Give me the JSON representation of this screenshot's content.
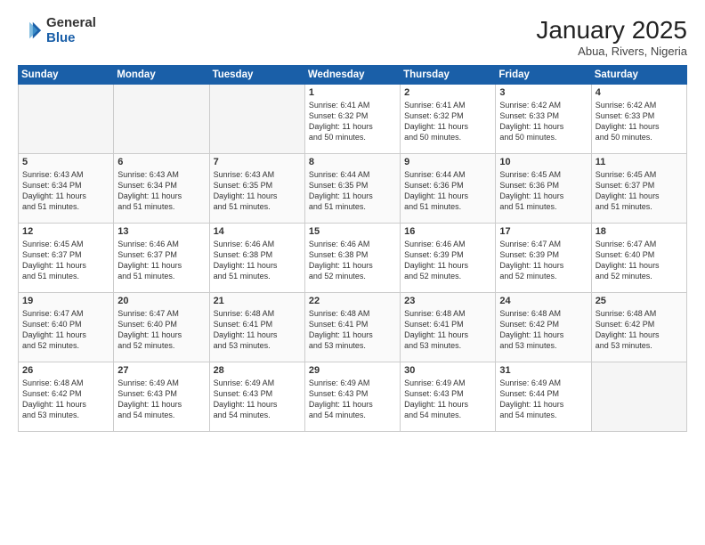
{
  "header": {
    "logo_general": "General",
    "logo_blue": "Blue",
    "month_title": "January 2025",
    "subtitle": "Abua, Rivers, Nigeria"
  },
  "weekdays": [
    "Sunday",
    "Monday",
    "Tuesday",
    "Wednesday",
    "Thursday",
    "Friday",
    "Saturday"
  ],
  "weeks": [
    [
      {
        "day": "",
        "info": ""
      },
      {
        "day": "",
        "info": ""
      },
      {
        "day": "",
        "info": ""
      },
      {
        "day": "1",
        "info": "Sunrise: 6:41 AM\nSunset: 6:32 PM\nDaylight: 11 hours\nand 50 minutes."
      },
      {
        "day": "2",
        "info": "Sunrise: 6:41 AM\nSunset: 6:32 PM\nDaylight: 11 hours\nand 50 minutes."
      },
      {
        "day": "3",
        "info": "Sunrise: 6:42 AM\nSunset: 6:33 PM\nDaylight: 11 hours\nand 50 minutes."
      },
      {
        "day": "4",
        "info": "Sunrise: 6:42 AM\nSunset: 6:33 PM\nDaylight: 11 hours\nand 50 minutes."
      }
    ],
    [
      {
        "day": "5",
        "info": "Sunrise: 6:43 AM\nSunset: 6:34 PM\nDaylight: 11 hours\nand 51 minutes."
      },
      {
        "day": "6",
        "info": "Sunrise: 6:43 AM\nSunset: 6:34 PM\nDaylight: 11 hours\nand 51 minutes."
      },
      {
        "day": "7",
        "info": "Sunrise: 6:43 AM\nSunset: 6:35 PM\nDaylight: 11 hours\nand 51 minutes."
      },
      {
        "day": "8",
        "info": "Sunrise: 6:44 AM\nSunset: 6:35 PM\nDaylight: 11 hours\nand 51 minutes."
      },
      {
        "day": "9",
        "info": "Sunrise: 6:44 AM\nSunset: 6:36 PM\nDaylight: 11 hours\nand 51 minutes."
      },
      {
        "day": "10",
        "info": "Sunrise: 6:45 AM\nSunset: 6:36 PM\nDaylight: 11 hours\nand 51 minutes."
      },
      {
        "day": "11",
        "info": "Sunrise: 6:45 AM\nSunset: 6:37 PM\nDaylight: 11 hours\nand 51 minutes."
      }
    ],
    [
      {
        "day": "12",
        "info": "Sunrise: 6:45 AM\nSunset: 6:37 PM\nDaylight: 11 hours\nand 51 minutes."
      },
      {
        "day": "13",
        "info": "Sunrise: 6:46 AM\nSunset: 6:37 PM\nDaylight: 11 hours\nand 51 minutes."
      },
      {
        "day": "14",
        "info": "Sunrise: 6:46 AM\nSunset: 6:38 PM\nDaylight: 11 hours\nand 51 minutes."
      },
      {
        "day": "15",
        "info": "Sunrise: 6:46 AM\nSunset: 6:38 PM\nDaylight: 11 hours\nand 52 minutes."
      },
      {
        "day": "16",
        "info": "Sunrise: 6:46 AM\nSunset: 6:39 PM\nDaylight: 11 hours\nand 52 minutes."
      },
      {
        "day": "17",
        "info": "Sunrise: 6:47 AM\nSunset: 6:39 PM\nDaylight: 11 hours\nand 52 minutes."
      },
      {
        "day": "18",
        "info": "Sunrise: 6:47 AM\nSunset: 6:40 PM\nDaylight: 11 hours\nand 52 minutes."
      }
    ],
    [
      {
        "day": "19",
        "info": "Sunrise: 6:47 AM\nSunset: 6:40 PM\nDaylight: 11 hours\nand 52 minutes."
      },
      {
        "day": "20",
        "info": "Sunrise: 6:47 AM\nSunset: 6:40 PM\nDaylight: 11 hours\nand 52 minutes."
      },
      {
        "day": "21",
        "info": "Sunrise: 6:48 AM\nSunset: 6:41 PM\nDaylight: 11 hours\nand 53 minutes."
      },
      {
        "day": "22",
        "info": "Sunrise: 6:48 AM\nSunset: 6:41 PM\nDaylight: 11 hours\nand 53 minutes."
      },
      {
        "day": "23",
        "info": "Sunrise: 6:48 AM\nSunset: 6:41 PM\nDaylight: 11 hours\nand 53 minutes."
      },
      {
        "day": "24",
        "info": "Sunrise: 6:48 AM\nSunset: 6:42 PM\nDaylight: 11 hours\nand 53 minutes."
      },
      {
        "day": "25",
        "info": "Sunrise: 6:48 AM\nSunset: 6:42 PM\nDaylight: 11 hours\nand 53 minutes."
      }
    ],
    [
      {
        "day": "26",
        "info": "Sunrise: 6:48 AM\nSunset: 6:42 PM\nDaylight: 11 hours\nand 53 minutes."
      },
      {
        "day": "27",
        "info": "Sunrise: 6:49 AM\nSunset: 6:43 PM\nDaylight: 11 hours\nand 54 minutes."
      },
      {
        "day": "28",
        "info": "Sunrise: 6:49 AM\nSunset: 6:43 PM\nDaylight: 11 hours\nand 54 minutes."
      },
      {
        "day": "29",
        "info": "Sunrise: 6:49 AM\nSunset: 6:43 PM\nDaylight: 11 hours\nand 54 minutes."
      },
      {
        "day": "30",
        "info": "Sunrise: 6:49 AM\nSunset: 6:43 PM\nDaylight: 11 hours\nand 54 minutes."
      },
      {
        "day": "31",
        "info": "Sunrise: 6:49 AM\nSunset: 6:44 PM\nDaylight: 11 hours\nand 54 minutes."
      },
      {
        "day": "",
        "info": ""
      }
    ]
  ]
}
